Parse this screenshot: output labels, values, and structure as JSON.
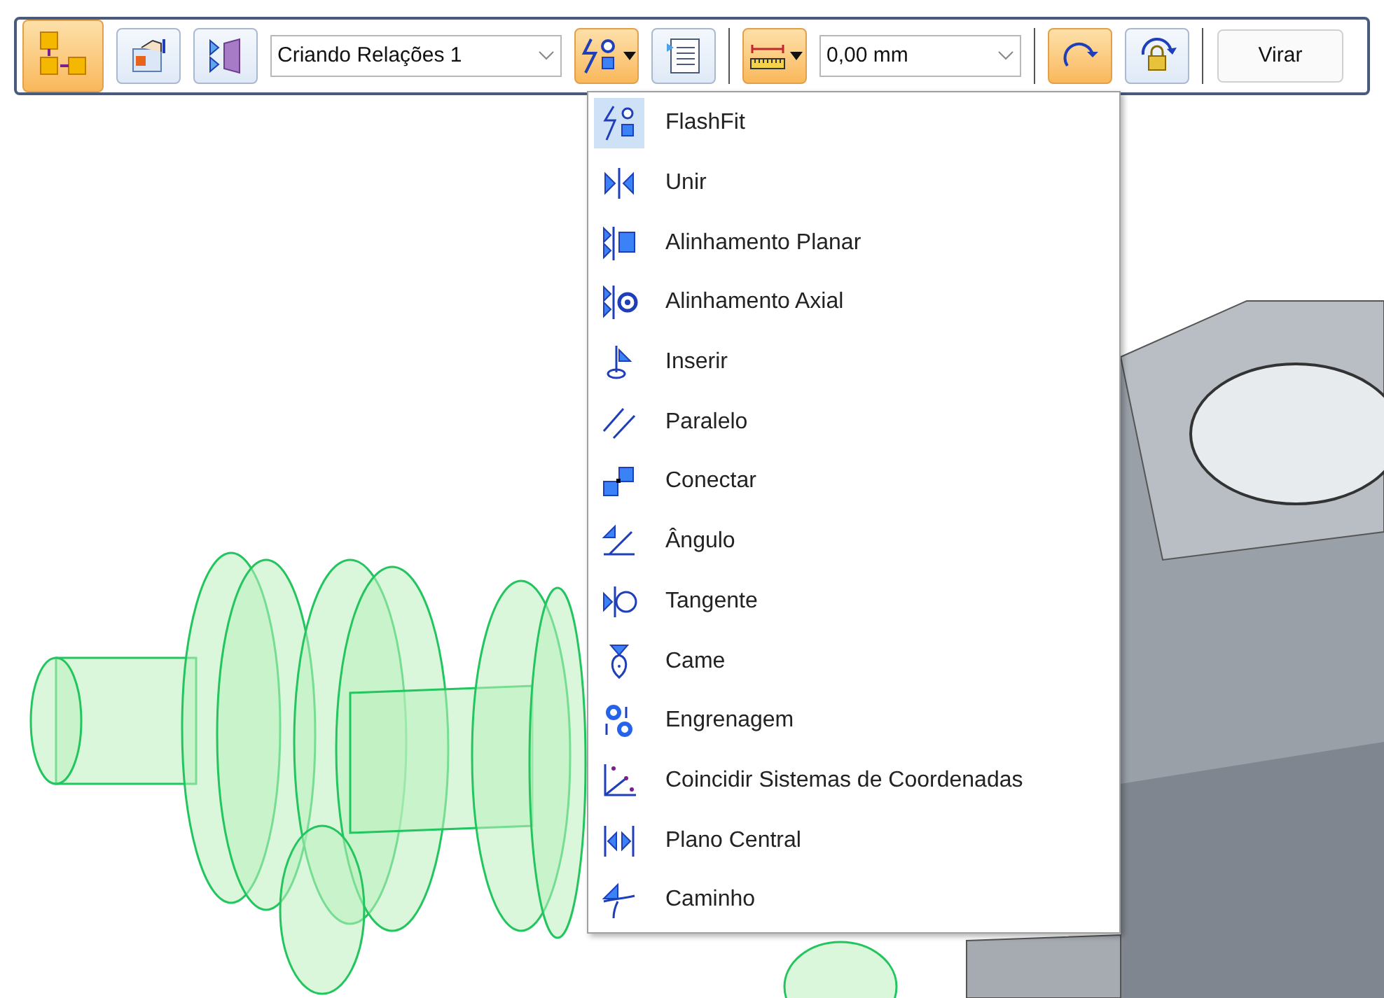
{
  "toolbar": {
    "items": [
      {
        "kind": "tool",
        "selected": true
      },
      {
        "kind": "tool",
        "selected": false
      },
      {
        "kind": "tool",
        "selected": false
      },
      {
        "kind": "combo",
        "value": "Criando Relações 1"
      },
      {
        "kind": "tool",
        "selected": true,
        "has_menu": true
      },
      {
        "kind": "tool",
        "selected": false
      },
      {
        "kind": "separator"
      },
      {
        "kind": "tool",
        "selected": true,
        "has_menu": true
      },
      {
        "kind": "combo",
        "value": "0,00 mm"
      },
      {
        "kind": "separator"
      },
      {
        "kind": "tool",
        "selected": true
      },
      {
        "kind": "tool",
        "selected": false
      },
      {
        "kind": "separator"
      },
      {
        "kind": "button",
        "label": "Virar"
      }
    ]
  },
  "menu": {
    "items": [
      {
        "label": "FlashFit",
        "selected": true
      },
      {
        "label": "Unir",
        "selected": false
      },
      {
        "label": "Alinhamento Planar",
        "selected": false
      },
      {
        "label": "Alinhamento Axial",
        "selected": false
      },
      {
        "label": "Inserir",
        "selected": false
      },
      {
        "label": "Paralelo",
        "selected": false
      },
      {
        "label": "Conectar",
        "selected": false
      },
      {
        "label": "Ângulo",
        "selected": false
      },
      {
        "label": "Tangente",
        "selected": false
      },
      {
        "label": "Came",
        "selected": false
      },
      {
        "label": "Engrenagem",
        "selected": false
      },
      {
        "label": "Coincidir Sistemas de Coordenadas",
        "selected": false
      },
      {
        "label": "Plano Central",
        "selected": false
      },
      {
        "label": "Caminho",
        "selected": false
      }
    ]
  }
}
